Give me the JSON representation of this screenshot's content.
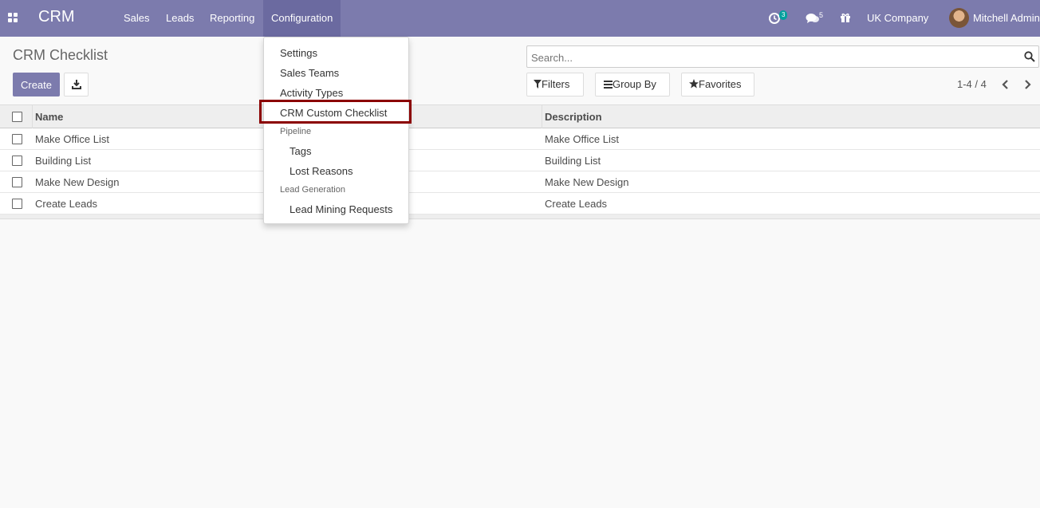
{
  "navbar": {
    "brand": "CRM",
    "menus": [
      "Sales",
      "Leads",
      "Reporting",
      "Configuration"
    ],
    "activity_count": "3",
    "messages_count": "5",
    "company": "UK Company",
    "user": "Mitchell Admin",
    "color": "#7c7bad"
  },
  "control_panel": {
    "title": "CRM Checklist",
    "create_label": "Create",
    "search_placeholder": "Search...",
    "filters_label": "Filters",
    "group_by_label": "Group By",
    "favorites_label": "Favorites",
    "pager": "1-4 / 4"
  },
  "table": {
    "columns": [
      "Name",
      "Description"
    ],
    "rows": [
      {
        "name": "Make Office List",
        "description": "Make Office List"
      },
      {
        "name": "Building List",
        "description": "Building List"
      },
      {
        "name": "Make New Design",
        "description": "Make New Design"
      },
      {
        "name": "Create Leads",
        "description": "Create Leads"
      }
    ]
  },
  "config_menu": {
    "settings": "Settings",
    "sales_teams": "Sales Teams",
    "activity_types": "Activity Types",
    "crm_custom_checklist": "CRM Custom Checklist",
    "pipeline_header": "Pipeline",
    "tags": "Tags",
    "lost_reasons": "Lost Reasons",
    "lead_generation_header": "Lead Generation",
    "lead_mining_requests": "Lead Mining Requests",
    "highlight_color": "#8b0000"
  }
}
